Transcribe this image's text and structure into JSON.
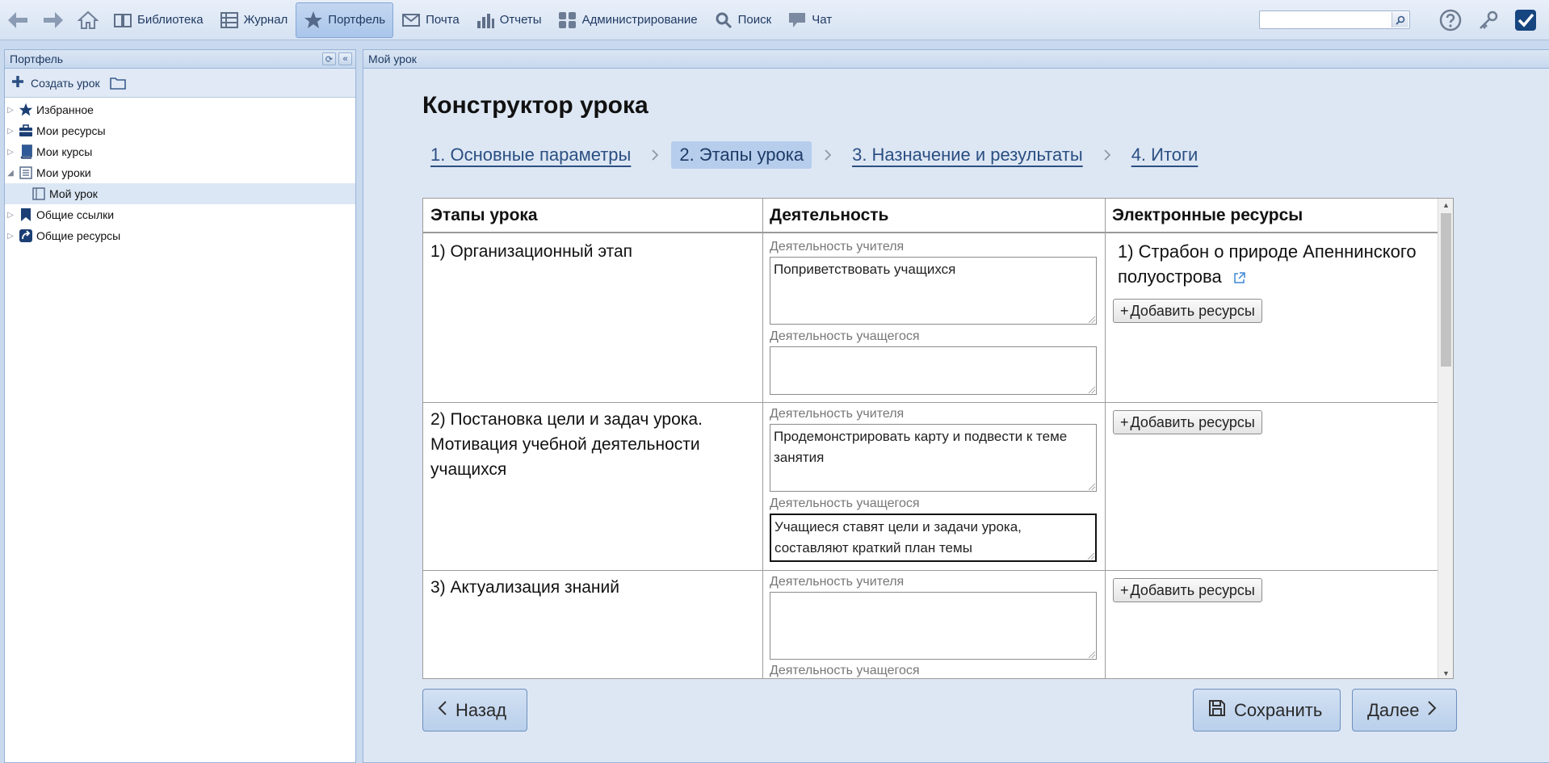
{
  "toolbar": {
    "items": [
      {
        "label": "Библиотека",
        "icon": "book-icon"
      },
      {
        "label": "Журнал",
        "icon": "journal-icon"
      },
      {
        "label": "Портфель",
        "icon": "star-icon"
      },
      {
        "label": "Почта",
        "icon": "mail-icon"
      },
      {
        "label": "Отчеты",
        "icon": "chart-icon"
      },
      {
        "label": "Администрирование",
        "icon": "admin-icon"
      },
      {
        "label": "Поиск",
        "icon": "magnifier-icon"
      },
      {
        "label": "Чат",
        "icon": "chat-icon"
      }
    ],
    "active_item": "Портфель",
    "search": {
      "value": "",
      "placeholder": ""
    }
  },
  "left_panel": {
    "title": "Портфель",
    "create_lesson_label": "Создать урок",
    "tree": [
      {
        "label": "Избранное",
        "icon": "star-icon"
      },
      {
        "label": "Мои ресурсы",
        "icon": "briefcase-icon"
      },
      {
        "label": "Мои курсы",
        "icon": "course-book-icon"
      },
      {
        "label": "Мои уроки",
        "icon": "lesson-icon",
        "expanded": true
      },
      {
        "label": "Мой урок",
        "icon": "page-icon",
        "selected": true
      },
      {
        "label": "Общие ссылки",
        "icon": "bookmark-icon"
      },
      {
        "label": "Общие ресурсы",
        "icon": "share-icon"
      }
    ]
  },
  "main": {
    "breadcrumb": "Мой урок",
    "title": "Конструктор урока",
    "steps": [
      {
        "label": "1. Основные параметры"
      },
      {
        "label": "2. Этапы урока",
        "active": true
      },
      {
        "label": "3. Назначение и результаты"
      },
      {
        "label": "4. Итоги"
      }
    ],
    "table": {
      "headers": [
        "Этапы урока",
        "Деятельность",
        "Электронные ресурсы"
      ],
      "teacher_label": "Деятельность учителя",
      "student_label": "Деятельность учащегося",
      "add_resources_label": "Добавить ресурсы",
      "rows": [
        {
          "stage": "1) Организационный этап",
          "teacher": "Поприветствовать учащихся",
          "student": "",
          "resources": [
            "1) Страбон о природе Апеннинского полуострова"
          ]
        },
        {
          "stage": "2) Постановка цели и задач урока. Мотивация учебной деятельности учащихся",
          "teacher": "Продемонстрировать карту и подвести к теме занятия",
          "student": "Учащиеся ставят цели и задачи урока, составляют краткий план темы",
          "resources": []
        },
        {
          "stage": "3) Актуализация знаний",
          "teacher": "",
          "student": "",
          "resources": []
        }
      ]
    },
    "buttons": {
      "back": "Назад",
      "save": "Сохранить",
      "next": "Далее"
    }
  },
  "colors": {
    "toolbar_bg": "#dfe8f5",
    "panel_border": "#99b4d7",
    "main_bg": "#dde7f4",
    "link": "#2b4f82",
    "active_step": "#b6cdec"
  }
}
